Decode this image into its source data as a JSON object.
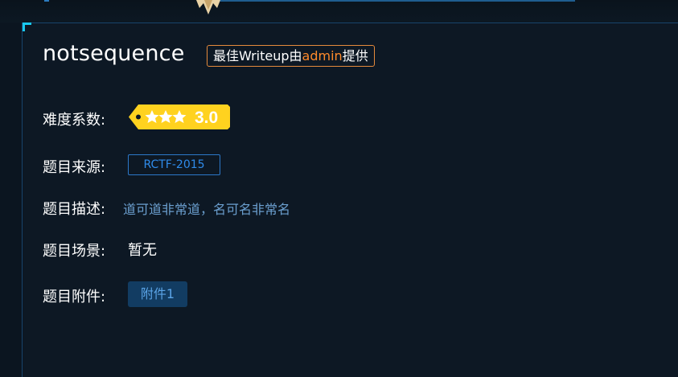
{
  "challenge": {
    "title": "notsequence",
    "writeup_badge": {
      "prefix": "最佳Writeup由",
      "user": "admin",
      "suffix": "提供"
    }
  },
  "fields": {
    "difficulty_label": "难度系数:",
    "difficulty_value": "3.0",
    "difficulty_stars": 3,
    "source_label": "题目来源:",
    "source_value": "RCTF-2015",
    "description_label": "题目描述:",
    "description_value": "道可道非常道，名可名非常名",
    "scene_label": "题目场景:",
    "scene_value": "暂无",
    "attachment_label": "题目附件:",
    "attachment_button": "附件1"
  },
  "colors": {
    "background": "#0d1824",
    "accent_cyan": "#19c9ef",
    "badge_orange": "#e58a3c",
    "admin_orange": "#ff8a2b",
    "source_blue": "#2f8bea",
    "description_blue": "#6b9fcf",
    "difficulty_yellow": "#ffd21f",
    "attachment_bg": "#123c62"
  },
  "icons": {
    "medal": "medal-icon",
    "difficulty_stars": "star-icon"
  }
}
